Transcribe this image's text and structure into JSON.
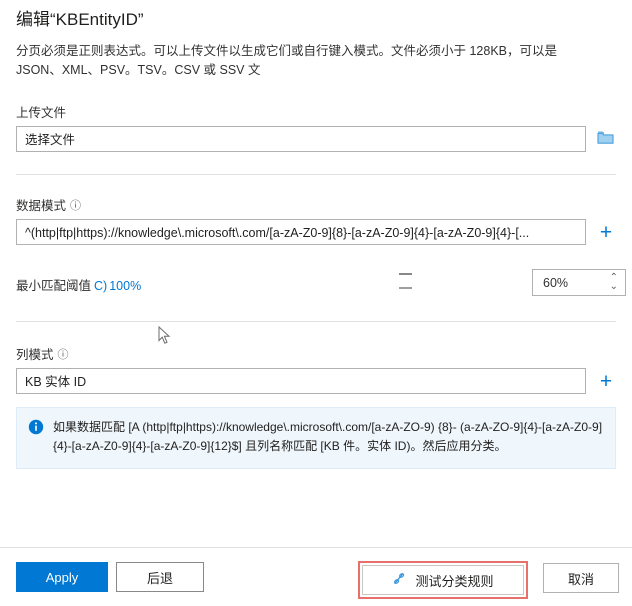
{
  "header": {
    "title": "编辑“KBEntityID”",
    "description": "分页必须是正则表达式。可以上传文件以生成它们或自行键入模式。文件必须小于 128KB，可以是 JSON、XML、PSV。TSV。CSV 或 SSV 文"
  },
  "upload": {
    "label": "上传文件",
    "value": "选择文件",
    "browse_icon": "folder-icon"
  },
  "data_pattern": {
    "label": "数据模式",
    "info_mark": "ⓘ",
    "value": "^(http|ftp|https)://knowledge\\.microsoft\\.com/[a-zA-Z0-9]{8}-[a-zA-Z0-9]{4}-[a-zA-Z0-9]{4}-[...",
    "add_label": "+"
  },
  "threshold": {
    "label": "最小匹配阈值",
    "suffix": "C)",
    "max_percent": "100%",
    "value": "60%",
    "stepper_up": "⌃",
    "stepper_down": "⌄"
  },
  "column_pattern": {
    "label": "列模式",
    "info_mark": "ⓘ",
    "value": "KB 实体 ID",
    "add_label": "+"
  },
  "info_banner": {
    "icon": "info-icon",
    "text": "如果数据匹配 [A (http|ftp|https)://knowledge\\.microsoft\\.com/[a-zA-ZO-9) {8}- (a-zA-ZO-9]{4}-[a-zA-Z0-9]{4}-[a-zA-Z0-9]{4}-[a-zA-Z0-9]{12}$] 且列名称匹配 [KB 件。实体 ID)。然后应用分类。"
  },
  "footer": {
    "apply_label": "Apply",
    "back_label": "后退",
    "test_label": "测试分类规则",
    "test_icon": "flask-icon",
    "cancel_label": "取消"
  },
  "colors": {
    "accent": "#0078d4",
    "highlight_border": "#e8706a",
    "info_background": "#eff6fc"
  }
}
